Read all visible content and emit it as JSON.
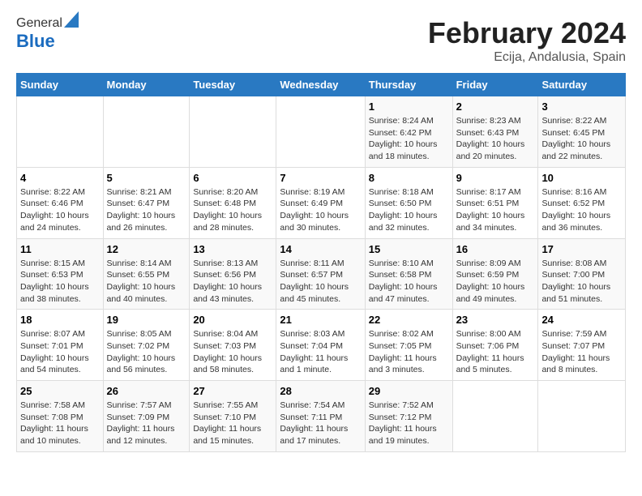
{
  "logo": {
    "general": "General",
    "blue": "Blue"
  },
  "header": {
    "month": "February 2024",
    "location": "Ecija, Andalusia, Spain"
  },
  "weekdays": [
    "Sunday",
    "Monday",
    "Tuesday",
    "Wednesday",
    "Thursday",
    "Friday",
    "Saturday"
  ],
  "weeks": [
    [
      {
        "day": "",
        "info": ""
      },
      {
        "day": "",
        "info": ""
      },
      {
        "day": "",
        "info": ""
      },
      {
        "day": "",
        "info": ""
      },
      {
        "day": "1",
        "info": "Sunrise: 8:24 AM\nSunset: 6:42 PM\nDaylight: 10 hours\nand 18 minutes."
      },
      {
        "day": "2",
        "info": "Sunrise: 8:23 AM\nSunset: 6:43 PM\nDaylight: 10 hours\nand 20 minutes."
      },
      {
        "day": "3",
        "info": "Sunrise: 8:22 AM\nSunset: 6:45 PM\nDaylight: 10 hours\nand 22 minutes."
      }
    ],
    [
      {
        "day": "4",
        "info": "Sunrise: 8:22 AM\nSunset: 6:46 PM\nDaylight: 10 hours\nand 24 minutes."
      },
      {
        "day": "5",
        "info": "Sunrise: 8:21 AM\nSunset: 6:47 PM\nDaylight: 10 hours\nand 26 minutes."
      },
      {
        "day": "6",
        "info": "Sunrise: 8:20 AM\nSunset: 6:48 PM\nDaylight: 10 hours\nand 28 minutes."
      },
      {
        "day": "7",
        "info": "Sunrise: 8:19 AM\nSunset: 6:49 PM\nDaylight: 10 hours\nand 30 minutes."
      },
      {
        "day": "8",
        "info": "Sunrise: 8:18 AM\nSunset: 6:50 PM\nDaylight: 10 hours\nand 32 minutes."
      },
      {
        "day": "9",
        "info": "Sunrise: 8:17 AM\nSunset: 6:51 PM\nDaylight: 10 hours\nand 34 minutes."
      },
      {
        "day": "10",
        "info": "Sunrise: 8:16 AM\nSunset: 6:52 PM\nDaylight: 10 hours\nand 36 minutes."
      }
    ],
    [
      {
        "day": "11",
        "info": "Sunrise: 8:15 AM\nSunset: 6:53 PM\nDaylight: 10 hours\nand 38 minutes."
      },
      {
        "day": "12",
        "info": "Sunrise: 8:14 AM\nSunset: 6:55 PM\nDaylight: 10 hours\nand 40 minutes."
      },
      {
        "day": "13",
        "info": "Sunrise: 8:13 AM\nSunset: 6:56 PM\nDaylight: 10 hours\nand 43 minutes."
      },
      {
        "day": "14",
        "info": "Sunrise: 8:11 AM\nSunset: 6:57 PM\nDaylight: 10 hours\nand 45 minutes."
      },
      {
        "day": "15",
        "info": "Sunrise: 8:10 AM\nSunset: 6:58 PM\nDaylight: 10 hours\nand 47 minutes."
      },
      {
        "day": "16",
        "info": "Sunrise: 8:09 AM\nSunset: 6:59 PM\nDaylight: 10 hours\nand 49 minutes."
      },
      {
        "day": "17",
        "info": "Sunrise: 8:08 AM\nSunset: 7:00 PM\nDaylight: 10 hours\nand 51 minutes."
      }
    ],
    [
      {
        "day": "18",
        "info": "Sunrise: 8:07 AM\nSunset: 7:01 PM\nDaylight: 10 hours\nand 54 minutes."
      },
      {
        "day": "19",
        "info": "Sunrise: 8:05 AM\nSunset: 7:02 PM\nDaylight: 10 hours\nand 56 minutes."
      },
      {
        "day": "20",
        "info": "Sunrise: 8:04 AM\nSunset: 7:03 PM\nDaylight: 10 hours\nand 58 minutes."
      },
      {
        "day": "21",
        "info": "Sunrise: 8:03 AM\nSunset: 7:04 PM\nDaylight: 11 hours\nand 1 minute."
      },
      {
        "day": "22",
        "info": "Sunrise: 8:02 AM\nSunset: 7:05 PM\nDaylight: 11 hours\nand 3 minutes."
      },
      {
        "day": "23",
        "info": "Sunrise: 8:00 AM\nSunset: 7:06 PM\nDaylight: 11 hours\nand 5 minutes."
      },
      {
        "day": "24",
        "info": "Sunrise: 7:59 AM\nSunset: 7:07 PM\nDaylight: 11 hours\nand 8 minutes."
      }
    ],
    [
      {
        "day": "25",
        "info": "Sunrise: 7:58 AM\nSunset: 7:08 PM\nDaylight: 11 hours\nand 10 minutes."
      },
      {
        "day": "26",
        "info": "Sunrise: 7:57 AM\nSunset: 7:09 PM\nDaylight: 11 hours\nand 12 minutes."
      },
      {
        "day": "27",
        "info": "Sunrise: 7:55 AM\nSunset: 7:10 PM\nDaylight: 11 hours\nand 15 minutes."
      },
      {
        "day": "28",
        "info": "Sunrise: 7:54 AM\nSunset: 7:11 PM\nDaylight: 11 hours\nand 17 minutes."
      },
      {
        "day": "29",
        "info": "Sunrise: 7:52 AM\nSunset: 7:12 PM\nDaylight: 11 hours\nand 19 minutes."
      },
      {
        "day": "",
        "info": ""
      },
      {
        "day": "",
        "info": ""
      }
    ]
  ]
}
